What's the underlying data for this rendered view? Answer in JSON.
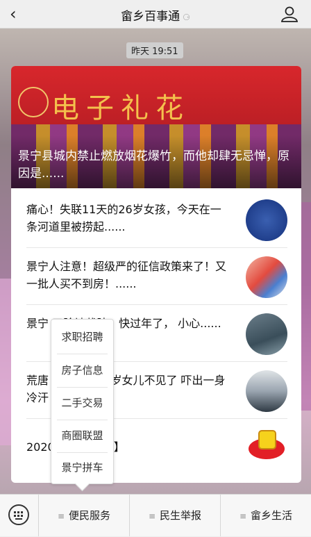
{
  "header": {
    "back_icon": "chevron-left-icon",
    "title": "畲乡百事通",
    "status_icon": "ear-icon",
    "profile_icon": "user-icon"
  },
  "chat": {
    "timestamp": "昨天 19:51"
  },
  "article_card": {
    "hero": {
      "sign_text": "电子礼花",
      "headline": "景宁县城内禁止燃放烟花爆竹，而他却肆无忌惮，原因是......"
    },
    "items": [
      {
        "title": "痛心！失联11天的26岁女孩，今天在一条河道里被捞起......",
        "thumb": "police-emblem"
      },
      {
        "title": "景宁人注意！超级严的征信政策来了！又一批人买不到房！......",
        "thumb": "credit-cards"
      },
      {
        "title": "景宁 了险被截肢！快过年了， 小心......",
        "thumb": "flood-water"
      },
      {
        "title": "荒唐 上开着，10岁女儿不见了 吓出一身冷汗！",
        "thumb": "officers-group"
      },
      {
        "title": "2020 【便民信息】",
        "thumb": "thumbs-up-100-badge"
      }
    ]
  },
  "popup_menu": {
    "items": [
      "求职招聘",
      "房子信息",
      "二手交易",
      "商圈联盟",
      "景宁拼车"
    ]
  },
  "bottom_bar": {
    "keyboard_icon": "keyboard-icon",
    "tabs": [
      {
        "label": "便民服务",
        "icon": "menu-lines-icon"
      },
      {
        "label": "民生举报",
        "icon": "menu-lines-icon"
      },
      {
        "label": "畲乡生活",
        "icon": "menu-lines-icon"
      }
    ]
  }
}
